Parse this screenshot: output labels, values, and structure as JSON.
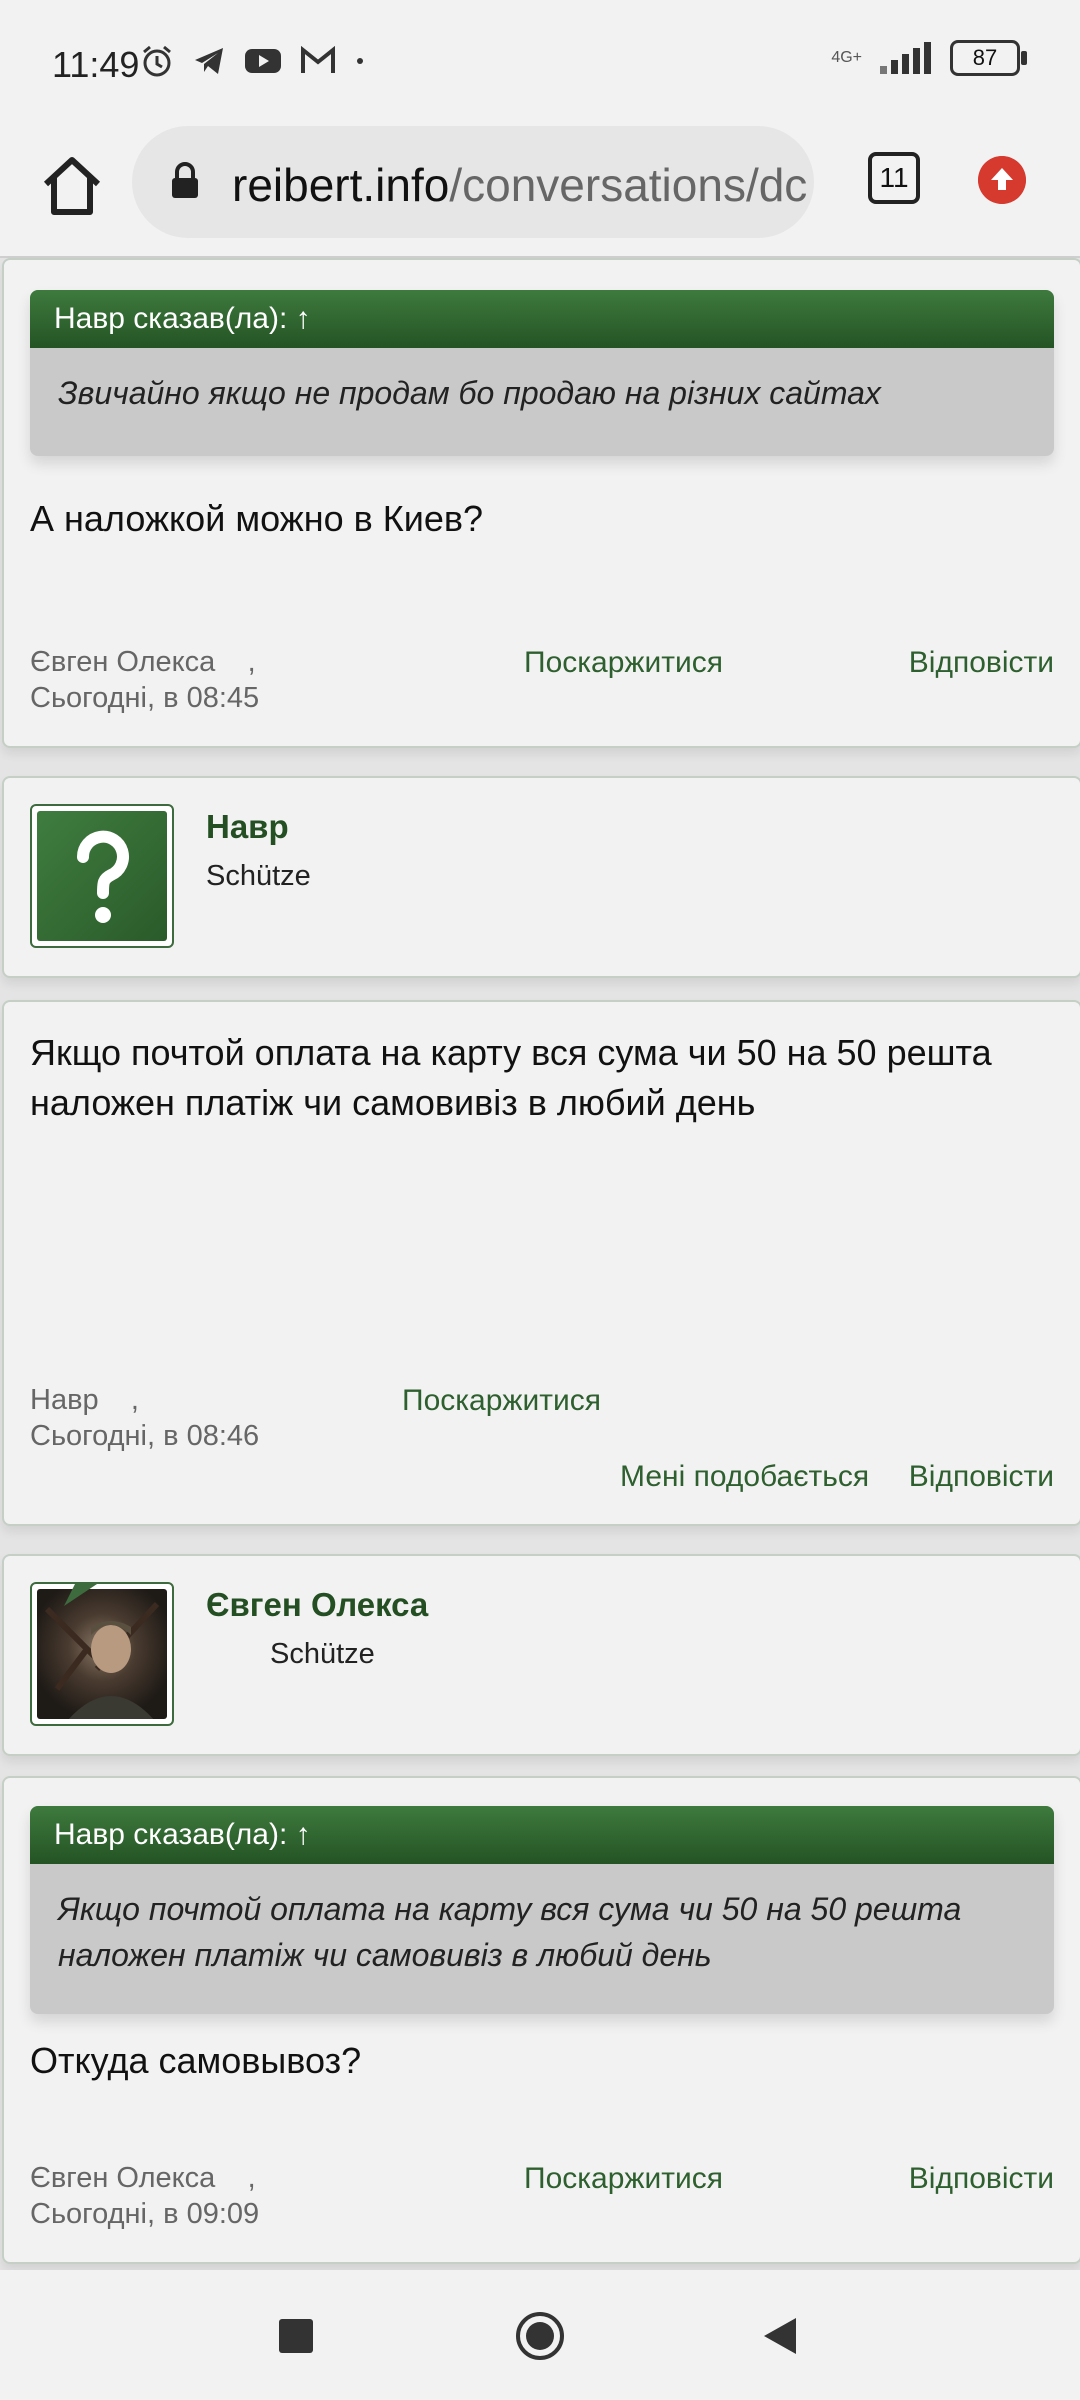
{
  "status_bar": {
    "time": "11:49",
    "network": "4G+",
    "battery": "87"
  },
  "browser": {
    "url_host": "reibert.info",
    "url_path": "/conversations/dc",
    "tab_count": "11"
  },
  "posts": [
    {
      "quote_header": "Навр сказав(ла): ↑",
      "quote_text": "Звичайно якщо не продам бо продаю на різних сайтах",
      "message": "А наложкой можно в Киев?",
      "author": "Євген Олекса",
      "sep": ",",
      "date": "Сьогодні, в 08:45",
      "report": "Поскаржитися",
      "reply": "Відповісти"
    },
    {
      "user": "Навр",
      "user_title": "Schütze",
      "message": "Якщо почтой оплата на карту вся сума чи 50 на 50 решта наложен платіж чи самовивіз в любий день",
      "author": "Навр",
      "sep": ",",
      "date": "Сьогодні, в 08:46",
      "report": "Поскаржитися",
      "like": "Мені подобається",
      "reply": "Відповісти"
    },
    {
      "user": "Євген Олекса",
      "user_title": "Schütze",
      "quote_header": "Навр сказав(ла): ↑",
      "quote_text": "Якщо почтой оплата на карту вся сума чи 50 на 50 решта наложен платіж чи самовивіз в любий день",
      "message": "Откуда самовывоз?",
      "author": "Євген Олекса",
      "sep": ",",
      "date": "Сьогодні, в 09:09",
      "report": "Поскаржитися",
      "reply": "Відповісти"
    }
  ],
  "colors": {
    "accent_green": "#2e5f2e",
    "update_red": "#d63a2f"
  }
}
